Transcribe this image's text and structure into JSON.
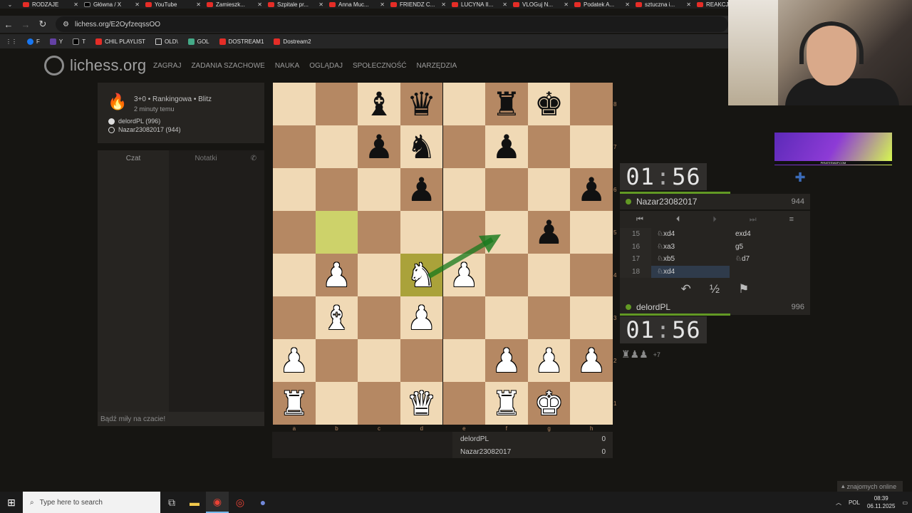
{
  "browser": {
    "tabs": [
      "RODZAJE",
      "Główna / X",
      "YouTube",
      "Zamieszk...",
      "Szpitale pr...",
      "Anna Muc...",
      "FRIENDZ C...",
      "LUCYNA II...",
      "VLOGuj N...",
      "Podatek A...",
      "sztuczna i...",
      "REAKCJA"
    ],
    "url": "lichess.org/E2OyfzeqssOO",
    "bookmarks": [
      "F",
      "Y",
      "T",
      "CHIL PLAYLIST",
      "OLD\\",
      "GOL",
      "DOSTREAM1",
      "Dostream2"
    ]
  },
  "site": {
    "logo": "lichess.org",
    "nav": [
      "ZAGRAJ",
      "ZADANIA SZACHOWE",
      "NAUKA",
      "OGLĄDAJ",
      "SPOŁECZNOŚĆ",
      "NARZĘDZIA"
    ]
  },
  "game": {
    "type": "3+0 • Rankingowa • Blitz",
    "time_ago": "2 minuty temu",
    "white_player": "delordPL (996)",
    "black_player": "Nazar23082017 (944)"
  },
  "chat": {
    "tab_chat": "Czat",
    "tab_notes": "Notatki",
    "input_placeholder": "Bądź miły na czacie!"
  },
  "board": {
    "ranks": [
      "8",
      "7",
      "6",
      "5",
      "4",
      "3",
      "2",
      "1"
    ],
    "files": [
      "a",
      "b",
      "c",
      "d",
      "e",
      "f",
      "g",
      "h"
    ],
    "position": [
      [
        "",
        "",
        "b:bishop",
        "b:queen",
        "",
        "b:rook",
        "b:king",
        ""
      ],
      [
        "",
        "",
        "b:pawn",
        "b:knight",
        "",
        "b:pawn",
        "",
        ""
      ],
      [
        "",
        "",
        "",
        "b:pawn",
        "",
        "",
        "",
        "b:pawn"
      ],
      [
        "",
        "",
        "",
        "",
        "",
        "",
        "b:pawn",
        ""
      ],
      [
        "",
        "w:pawn",
        "",
        "w:knight",
        "w:pawn",
        "",
        "",
        ""
      ],
      [
        "",
        "w:bishop",
        "",
        "w:pawn",
        "",
        "",
        "",
        ""
      ],
      [
        "w:pawn",
        "",
        "",
        "",
        "",
        "w:pawn",
        "w:pawn",
        "w:pawn"
      ],
      [
        "w:rook",
        "",
        "",
        "w:queen",
        "",
        "w:rook",
        "w:king",
        ""
      ]
    ],
    "highlights": [
      "b5",
      "d4"
    ],
    "arrow": {
      "from": "d4",
      "to": "f5"
    }
  },
  "score": {
    "rows": [
      {
        "name": "delordPL",
        "score": "0"
      },
      {
        "name": "Nazar23082017",
        "score": "0"
      }
    ]
  },
  "clocks": {
    "top": {
      "min": "01",
      "sec": "56"
    },
    "bottom": {
      "min": "01",
      "sec": "56"
    },
    "top_remaining": 0.58,
    "bottom_remaining": 0.58
  },
  "players": {
    "top": {
      "name": "Nazar23082017",
      "rating": "944"
    },
    "bottom": {
      "name": "delordPL",
      "rating": "996"
    }
  },
  "moves": [
    {
      "n": "15",
      "w": "♘xd4",
      "b": "exd4"
    },
    {
      "n": "16",
      "w": "♘xa3",
      "b": "g5"
    },
    {
      "n": "17",
      "w": "♘xb5",
      "b": "♘d7"
    },
    {
      "n": "18",
      "w": "♘xd4",
      "b": ""
    }
  ],
  "material": {
    "pieces": "♜♟♟",
    "diff": "+7"
  },
  "ad": {
    "text": "PIRATESWAP.COM"
  },
  "footer": {
    "friends": "znajomych online"
  },
  "taskbar": {
    "search_placeholder": "Type here to search",
    "lang": "POL",
    "time": "08:39",
    "date": "06.11.2025"
  },
  "colors": {
    "light_square": "#f0d9b5",
    "dark_square": "#b58863",
    "highlight": "#cdd26a",
    "accent_green": "#629924",
    "arrow": "#15781b"
  }
}
